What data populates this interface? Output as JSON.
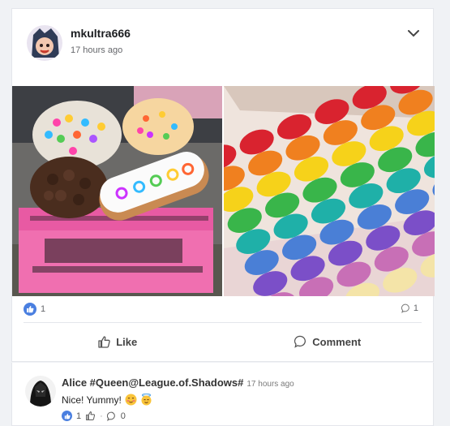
{
  "post": {
    "author": "mkultra666",
    "time": "17 hours ago",
    "likes": "1",
    "comments": "1",
    "like_label": "Like",
    "comment_label": "Comment",
    "photos": [
      "doughnuts-photo",
      "macarons-photo"
    ]
  },
  "comment": {
    "author": "Alice #Queen@League.of.Shadows#",
    "time": "17 hours ago",
    "text": "Nice! Yummy!",
    "likes": "1",
    "replies": "0"
  },
  "colors": {
    "accent": "#4a7fe0",
    "pink_box": "#f06fb0"
  }
}
